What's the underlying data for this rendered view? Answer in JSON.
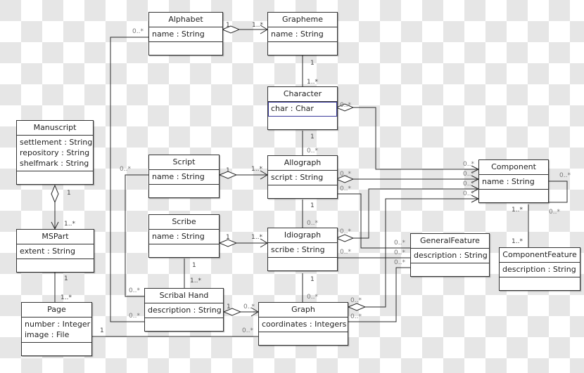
{
  "diagram": {
    "type": "UML class diagram",
    "classes": {
      "alphabet": {
        "name": "Alphabet",
        "attributes": [
          "name : String"
        ]
      },
      "grapheme": {
        "name": "Grapheme",
        "attributes": [
          "name : String"
        ]
      },
      "character": {
        "name": "Character",
        "attributes": [
          "char : Char"
        ]
      },
      "manuscript": {
        "name": "Manuscript",
        "attributes": [
          "settlement : String",
          "repository : String",
          "shelfmark : String"
        ]
      },
      "script": {
        "name": "Script",
        "attributes": [
          "name : String"
        ]
      },
      "allograph": {
        "name": "Allograph",
        "attributes": [
          "script : String"
        ]
      },
      "component": {
        "name": "Component",
        "attributes": [
          "name : String"
        ]
      },
      "mspart": {
        "name": "MSPart",
        "attributes": [
          "extent : String"
        ]
      },
      "scribe": {
        "name": "Scribe",
        "attributes": [
          "name : String"
        ]
      },
      "idiograph": {
        "name": "Idiograph",
        "attributes": [
          "scribe : String"
        ]
      },
      "generalfeature": {
        "name": "GeneralFeature",
        "attributes": [
          "description : String"
        ]
      },
      "componentfeature": {
        "name": "ComponentFeature",
        "attributes": [
          "description : String"
        ]
      },
      "scribalhand": {
        "name": "Scribal Hand",
        "attributes": [
          "description : String"
        ]
      },
      "page": {
        "name": "Page",
        "attributes": [
          "number : Integer",
          "image : File"
        ]
      },
      "graph": {
        "name": "Graph",
        "attributes": [
          "coordinates : Integers"
        ]
      }
    },
    "multiplicities": {
      "one": "1",
      "one_many": "1..*",
      "zero_many": "0..*"
    },
    "associations": [
      {
        "from": "Alphabet",
        "to": "Grapheme",
        "kind": "aggregation",
        "from_mult": "1",
        "to_mult": "1..*"
      },
      {
        "from": "Grapheme",
        "to": "Character",
        "kind": "association",
        "from_mult": "1",
        "to_mult": "1..*"
      },
      {
        "from": "Character",
        "to": "Allograph",
        "kind": "association",
        "from_mult": "1",
        "to_mult": "0..*"
      },
      {
        "from": "Character",
        "to": "Component",
        "kind": "aggregation",
        "from_mult": "0..*",
        "to_mult": "0..*"
      },
      {
        "from": "Manuscript",
        "to": "MSPart",
        "kind": "aggregation",
        "from_mult": "1",
        "to_mult": "1..*"
      },
      {
        "from": "Script",
        "to": "Allograph",
        "kind": "aggregation",
        "from_mult": "1",
        "to_mult": "1..*"
      },
      {
        "from": "Allograph",
        "to": "Component",
        "kind": "aggregation",
        "from_mult": "0..*",
        "to_mult": "0..*"
      },
      {
        "from": "Allograph",
        "to": "GeneralFeature",
        "kind": "association",
        "from_mult": "0..*",
        "to_mult": "0..*"
      },
      {
        "from": "Allograph",
        "to": "Idiograph",
        "kind": "association",
        "from_mult": "1",
        "to_mult": "0..*"
      },
      {
        "from": "Component",
        "to": "Component",
        "kind": "association",
        "from_mult": "0..*",
        "to_mult": "0..*"
      },
      {
        "from": "Component",
        "to": "ComponentFeature",
        "kind": "association",
        "from_mult": "1..*",
        "to_mult": "1..*"
      },
      {
        "from": "MSPart",
        "to": "Page",
        "kind": "association",
        "from_mult": "1",
        "to_mult": "1..*"
      },
      {
        "from": "Scribe",
        "to": "Idiograph",
        "kind": "aggregation",
        "from_mult": "1",
        "to_mult": "1..*"
      },
      {
        "from": "Scribe",
        "to": "Scribal Hand",
        "kind": "association",
        "from_mult": "1",
        "to_mult": "1..*"
      },
      {
        "from": "Idiograph",
        "to": "Component",
        "kind": "aggregation",
        "from_mult": "0..*",
        "to_mult": "0..*"
      },
      {
        "from": "Idiograph",
        "to": "GeneralFeature",
        "kind": "association",
        "from_mult": "0..*",
        "to_mult": "0..*"
      },
      {
        "from": "Idiograph",
        "to": "Graph",
        "kind": "association",
        "from_mult": "1",
        "to_mult": "0..*"
      },
      {
        "from": "Alphabet",
        "to": "Scribal Hand",
        "kind": "association",
        "from_mult": "0..*",
        "to_mult": "0..*"
      },
      {
        "from": "Script",
        "to": "Scribal Hand",
        "kind": "association",
        "from_mult": "0..*",
        "to_mult": "0..*"
      },
      {
        "from": "Scribal Hand",
        "to": "Graph",
        "kind": "aggregation",
        "from_mult": "1",
        "to_mult": "0..*"
      },
      {
        "from": "Page",
        "to": "Graph",
        "kind": "association",
        "from_mult": "1",
        "to_mult": "0..*"
      },
      {
        "from": "Graph",
        "to": "Component",
        "kind": "aggregation",
        "from_mult": "0..*",
        "to_mult": "0..*"
      },
      {
        "from": "Graph",
        "to": "GeneralFeature",
        "kind": "association",
        "from_mult": "0..*",
        "to_mult": "0..*"
      }
    ]
  }
}
